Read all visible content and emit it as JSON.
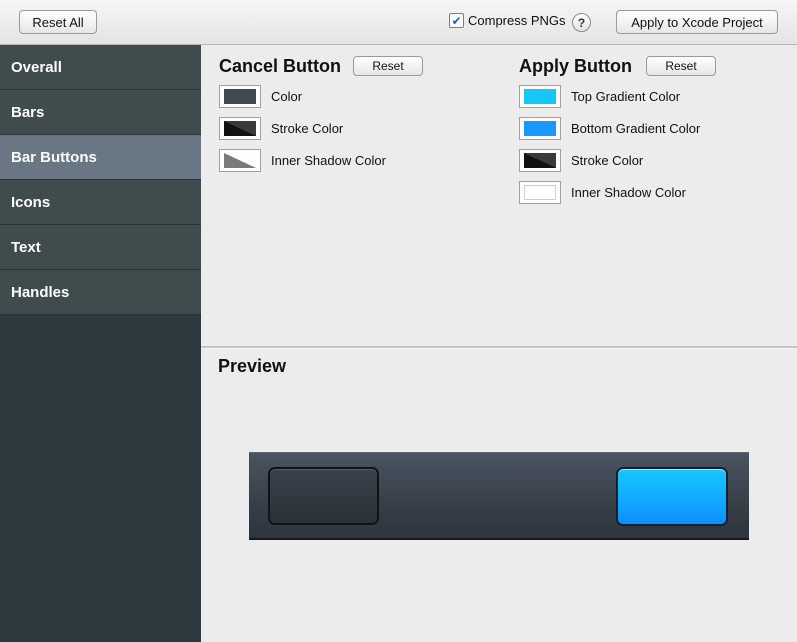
{
  "toolbar": {
    "reset_all_label": "Reset All",
    "compress_label": "Compress PNGs",
    "compress_checked": true,
    "help_label": "?",
    "apply_xcode_label": "Apply to Xcode Project"
  },
  "sidebar": {
    "items": [
      {
        "label": "Overall",
        "selected": false
      },
      {
        "label": "Bars",
        "selected": false
      },
      {
        "label": "Bar Buttons",
        "selected": true
      },
      {
        "label": "Icons",
        "selected": false
      },
      {
        "label": "Text",
        "selected": false
      },
      {
        "label": "Handles",
        "selected": false
      }
    ]
  },
  "cancel_section": {
    "title": "Cancel Button",
    "reset_label": "Reset",
    "rows": [
      {
        "label": "Color",
        "swatch": "solid",
        "color": "#3f4a52"
      },
      {
        "label": "Stroke Color",
        "swatch": "split",
        "color": "#111111",
        "color2": "#3a3a3a"
      },
      {
        "label": "Inner Shadow Color",
        "swatch": "split",
        "color": "#7a7a7a",
        "color2": "#ffffff"
      }
    ]
  },
  "apply_section": {
    "title": "Apply Button",
    "reset_label": "Reset",
    "rows": [
      {
        "label": "Top Gradient Color",
        "swatch": "solid",
        "color": "#16c6f5"
      },
      {
        "label": "Bottom Gradient Color",
        "swatch": "solid",
        "color": "#1998ff"
      },
      {
        "label": "Stroke Color",
        "swatch": "split",
        "color": "#111111",
        "color2": "#3a3a3a"
      },
      {
        "label": "Inner Shadow Color",
        "swatch": "solid",
        "color": "#ffffff"
      }
    ]
  },
  "preview": {
    "title": "Preview"
  }
}
